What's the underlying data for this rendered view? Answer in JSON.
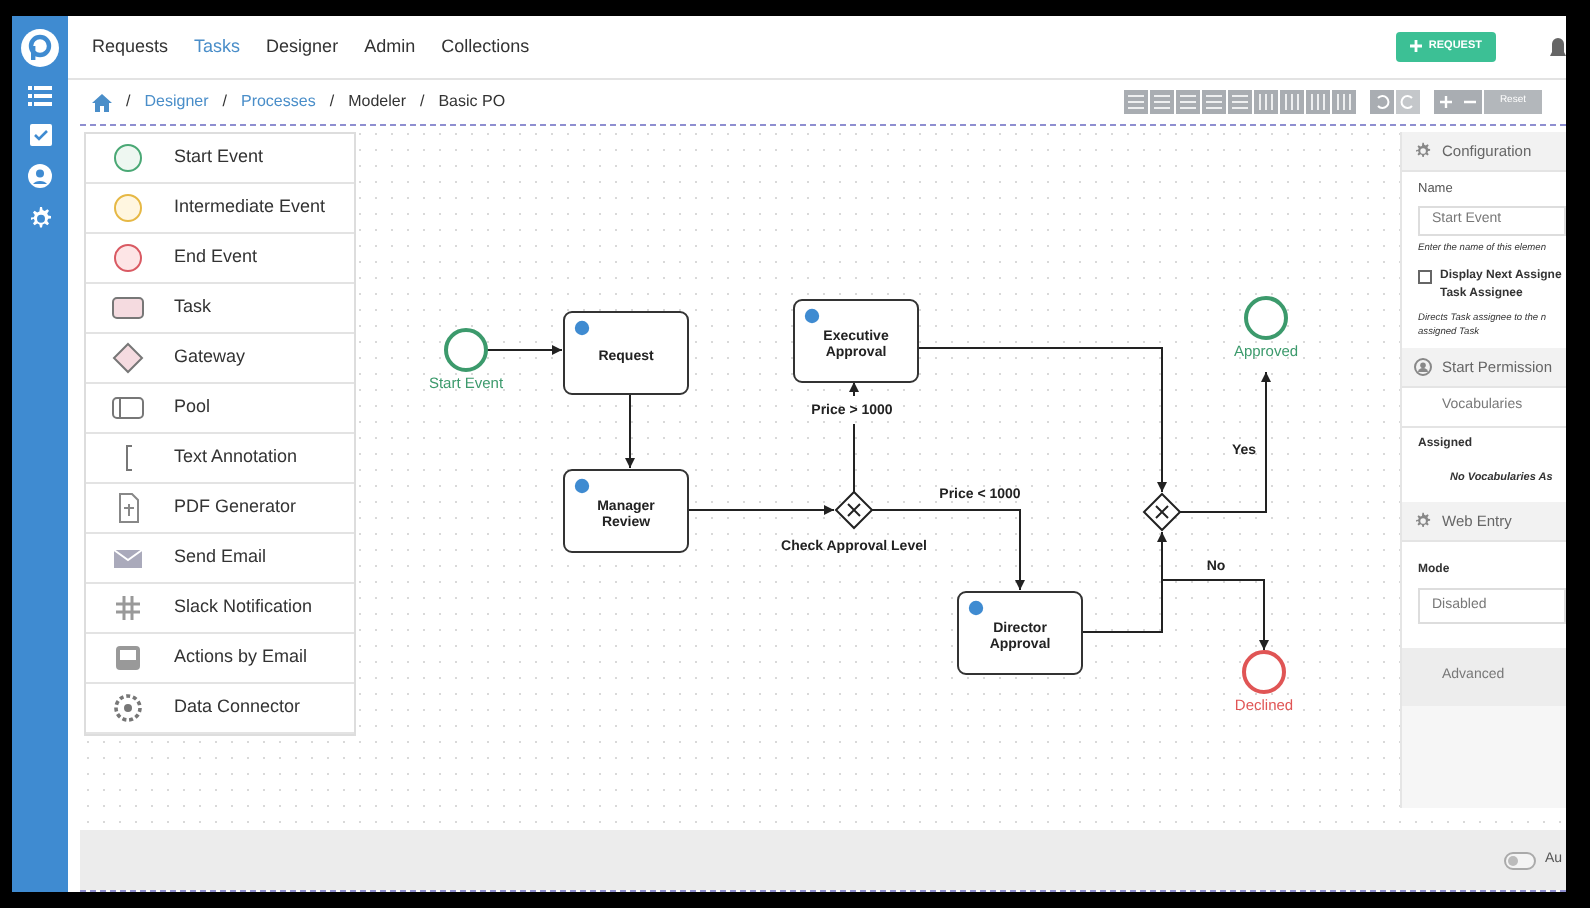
{
  "nav": {
    "tabs": [
      {
        "label": "Requests",
        "selected": false
      },
      {
        "label": "Tasks",
        "selected": true
      },
      {
        "label": "Designer",
        "selected": false
      },
      {
        "label": "Admin",
        "selected": false
      },
      {
        "label": "Collections",
        "selected": false
      }
    ],
    "request_button": "REQUEST"
  },
  "breadcrumb": [
    {
      "separator": "/",
      "label": "Designer",
      "link": true
    },
    {
      "separator": "/",
      "label": "Processes",
      "link": true
    },
    {
      "separator": "/",
      "label": "Modeler",
      "link": false
    },
    {
      "separator": "/",
      "label": "Basic PO",
      "link": false
    }
  ],
  "toolbar": {
    "reset": "Reset"
  },
  "palette": [
    {
      "label": "Start Event",
      "kind": "start"
    },
    {
      "label": "Intermediate Event",
      "kind": "intermediate"
    },
    {
      "label": "End Event",
      "kind": "end"
    },
    {
      "label": "Task",
      "kind": "task"
    },
    {
      "label": "Gateway",
      "kind": "gateway"
    },
    {
      "label": "Pool",
      "kind": "pool"
    },
    {
      "label": "Text Annotation",
      "kind": "annotation"
    },
    {
      "label": "PDF Generator",
      "kind": "pdf"
    },
    {
      "label": "Send Email",
      "kind": "email"
    },
    {
      "label": "Slack Notification",
      "kind": "slack"
    },
    {
      "label": "Actions by Email",
      "kind": "actions"
    },
    {
      "label": "Data Connector",
      "kind": "connector"
    }
  ],
  "diagram": {
    "nodes": [
      {
        "kind": "start",
        "label": "Start Event"
      },
      {
        "kind": "task",
        "label": "Request"
      },
      {
        "kind": "task",
        "label": "Manager Review"
      },
      {
        "kind": "task",
        "label": "Executive Approval"
      },
      {
        "kind": "gateway",
        "label": "Check Approval Level"
      },
      {
        "kind": "task",
        "label": "Director Approval"
      },
      {
        "kind": "gateway"
      },
      {
        "kind": "end_ok",
        "label": "Approved"
      },
      {
        "kind": "end_fail",
        "label": "Declined"
      }
    ],
    "flow_labels": [
      "Price > 1000",
      "Price < 1000",
      "Yes",
      "No"
    ]
  },
  "properties": {
    "configuration": "Configuration",
    "name_label": "Name",
    "name_value": "Start Event",
    "name_help": "Enter the name of this elemen",
    "checkbox": {
      "label": "Display Next Assigne",
      "label_2": "Task Assignee",
      "checked": false
    },
    "checkbox_help": "Directs Task assignee to the n",
    "checkbox_help_2": "assigned Task",
    "start_permissions": "Start Permission",
    "vocabularies": "Vocabularies",
    "assigned": "Assigned",
    "no_vocabularies": "No Vocabularies As",
    "web_entry": "Web Entry",
    "mode_label": "Mode",
    "mode_value": "Disabled",
    "advanced": "Advanced"
  },
  "footer": {
    "toggle_label": "Au",
    "on": false
  }
}
